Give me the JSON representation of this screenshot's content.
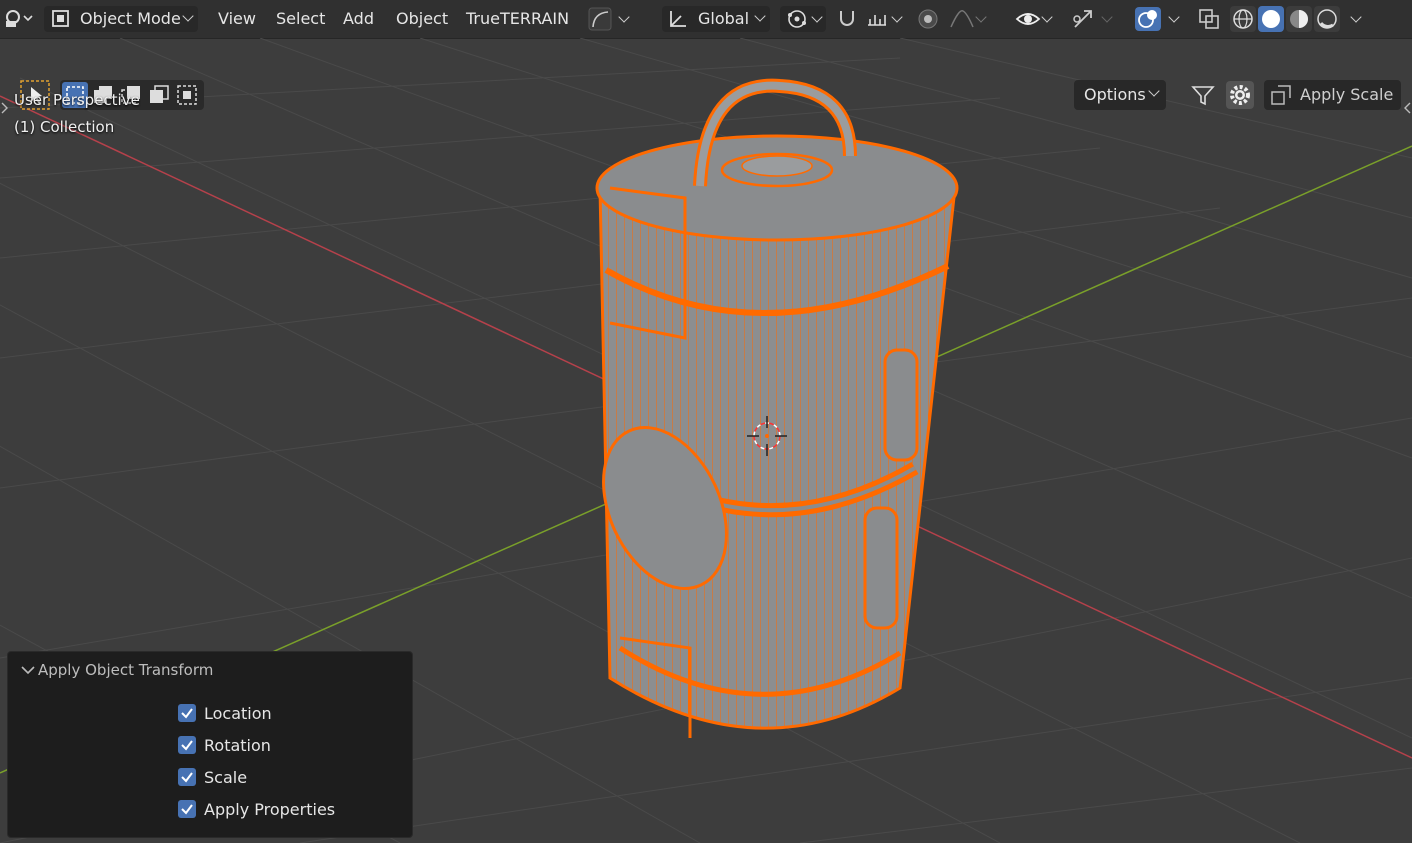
{
  "header": {
    "mode_label": "Object Mode",
    "menus": [
      "View",
      "Select",
      "Add",
      "Object",
      "TrueTERRAIN"
    ],
    "transform_orientation": "Global"
  },
  "toolbar2": {
    "options_label": "Options",
    "apply_scale_label": "Apply Scale"
  },
  "viewport": {
    "perspective_label": "User Perspective",
    "collection_label": "(1) Collection"
  },
  "operator_panel": {
    "title": "Apply Object Transform",
    "options": [
      {
        "label": "Location",
        "checked": true
      },
      {
        "label": "Rotation",
        "checked": true
      },
      {
        "label": "Scale",
        "checked": true
      },
      {
        "label": "Apply Properties",
        "checked": true
      }
    ]
  },
  "colors": {
    "selection_outline": "#ff6a00",
    "x_axis": "#b5414b",
    "y_axis": "#7aa02a",
    "accent": "#4772b3"
  },
  "icons": [
    "editor-type-icon",
    "object-mode-icon",
    "curve-icon",
    "transform-orientation-icon",
    "pivot-icon",
    "snap-icon",
    "snap-increment-icon",
    "proportional-edit-icon",
    "falloff-icon",
    "visibility-icon",
    "gizmo-icon",
    "overlay-icon",
    "xray-icon",
    "wireframe-shading-icon",
    "solid-shading-icon",
    "material-shading-icon",
    "rendered-shading-icon",
    "select-tool-icon",
    "filter-icon",
    "gear-icon"
  ]
}
